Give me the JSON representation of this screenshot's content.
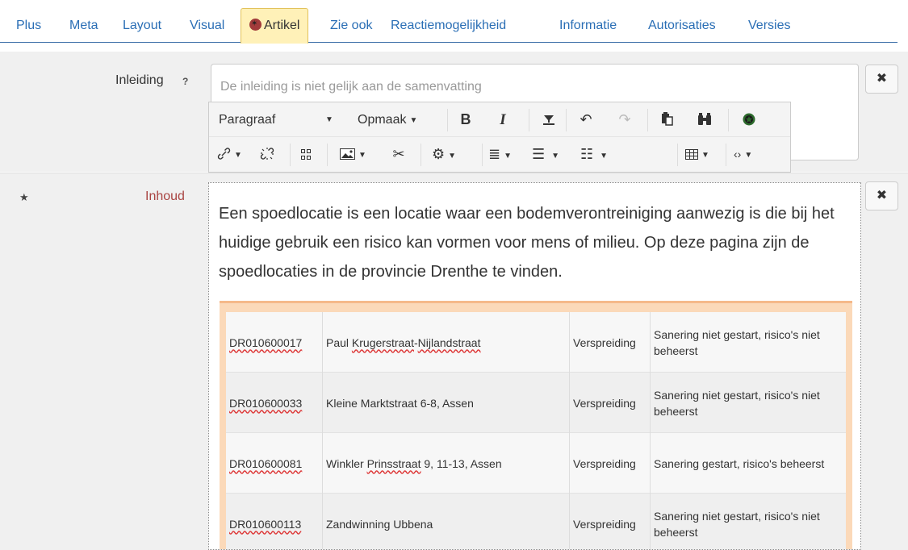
{
  "tabs": [
    {
      "label": "Plus"
    },
    {
      "label": "Meta"
    },
    {
      "label": "Layout"
    },
    {
      "label": "Visual"
    },
    {
      "label": "Artikel",
      "active": true
    },
    {
      "label": "Zie ook"
    },
    {
      "label": "Reactiemogelijkheid"
    },
    {
      "label": "Informatie"
    },
    {
      "label": "Autorisaties"
    },
    {
      "label": "Versies"
    }
  ],
  "fields": {
    "inleiding": {
      "label": "Inleiding",
      "help": "?",
      "placeholder": "De inleiding is niet gelijk aan de samenvatting"
    },
    "inhoud": {
      "label": "Inhoud",
      "required": "★"
    },
    "delete": "✖"
  },
  "toolbar": {
    "format_block": "Paragraaf",
    "styles": "Opmaak",
    "bold": "B",
    "italic": "I"
  },
  "content": {
    "intro_text": "Een spoedlocatie is een locatie waar een bodemverontreiniging aanwezig is die bij het huidige gebruik een risico kan vormen voor mens of milieu. Op deze pagina zijn de spoedlocaties in de provincie Drenthe te vinden."
  },
  "table": {
    "rows": [
      {
        "code": "DR010600017",
        "name_a": "Paul ",
        "name_b": "Krugerstraat",
        "name_c": "-",
        "name_d": "Nijlandstraat",
        "name_e": "",
        "type": "Verspreiding",
        "status": "Sanering niet gestart, risico's niet beheerst"
      },
      {
        "code": "DR010600033",
        "name_a": "Kleine Marktstraat 6-8, Assen",
        "name_b": "",
        "name_c": "",
        "name_d": "",
        "name_e": "",
        "type": "Verspreiding",
        "status": "Sanering niet gestart, risico's niet beheerst"
      },
      {
        "code": "DR010600081",
        "name_a": "Winkler ",
        "name_b": "Prinsstraat",
        "name_c": " 9, 11-13, Assen",
        "name_d": "",
        "name_e": "",
        "type": "Verspreiding",
        "status": "Sanering gestart, risico's beheerst"
      },
      {
        "code": "DR010600113",
        "name_a": "Zandwinning Ubbena",
        "name_b": "",
        "name_c": "",
        "name_d": "",
        "name_e": "",
        "type": "Verspreiding",
        "status": "Sanering niet gestart, risico's niet beheerst"
      }
    ]
  },
  "colors": {
    "tab_link": "#2a6eb5",
    "active_tab_bg": "#fff1b8",
    "required_label": "#a94442",
    "table_border": "#f5b98a"
  },
  "icons": [
    "artikel-badge-icon",
    "chevron-down-icon",
    "clear-format-icon",
    "undo-icon",
    "redo-icon",
    "paste-icon",
    "find-icon",
    "special-char-icon",
    "link-icon",
    "unlink-icon",
    "grid-icon",
    "image-icon",
    "cut-icon",
    "gear-icon",
    "align-icon",
    "bullet-list-icon",
    "numbered-list-icon",
    "table-icon",
    "source-code-icon",
    "close-icon"
  ]
}
